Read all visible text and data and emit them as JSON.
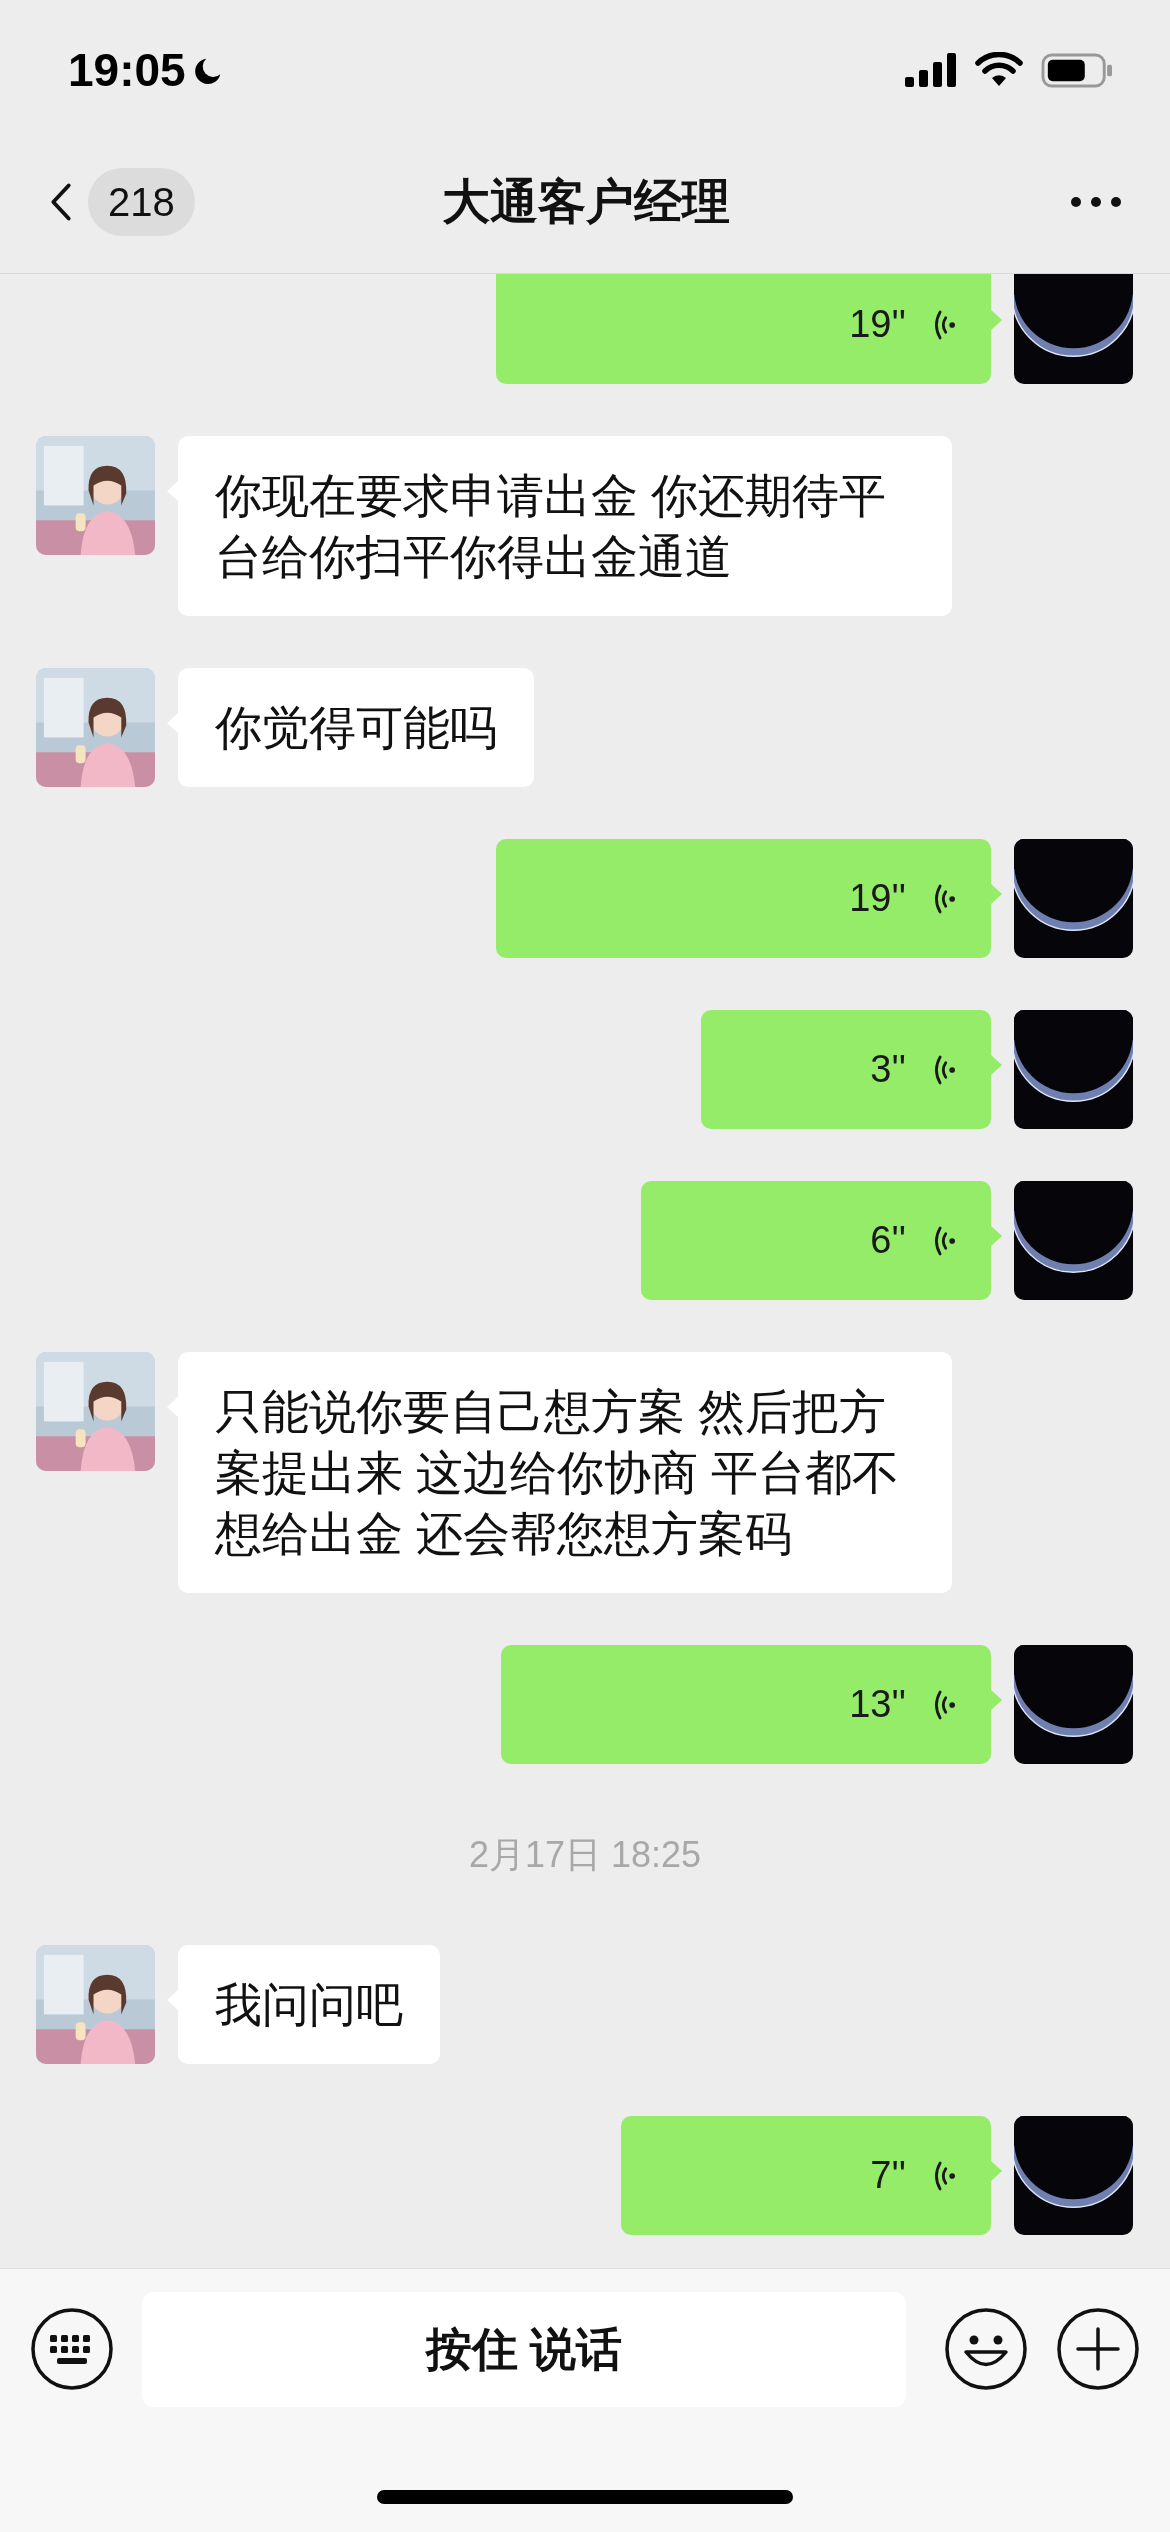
{
  "status_bar": {
    "time": "19:05"
  },
  "header": {
    "back_badge": "218",
    "title": "大通客户经理"
  },
  "messages": [
    {
      "kind": "voice",
      "duration": "19''"
    },
    {
      "kind": "text",
      "text": "你现在要求申请出金 你还期待平台给你扫平你得出金通道"
    },
    {
      "kind": "text",
      "text": "你觉得可能吗"
    },
    {
      "kind": "voice",
      "duration": "19''"
    },
    {
      "kind": "voice",
      "duration": "3''"
    },
    {
      "kind": "voice",
      "duration": "6''"
    },
    {
      "kind": "text",
      "text": "只能说你要自己想方案 然后把方案提出来 这边给你协商 平台都不想给出金 还会帮您想方案码"
    },
    {
      "kind": "voice",
      "duration": "13''"
    },
    {
      "kind": "timestamp",
      "text": "2月17日 18:25"
    },
    {
      "kind": "text",
      "text": "我问问吧"
    },
    {
      "kind": "voice",
      "duration": "7''"
    }
  ],
  "input_bar": {
    "label": "按住 说话"
  }
}
